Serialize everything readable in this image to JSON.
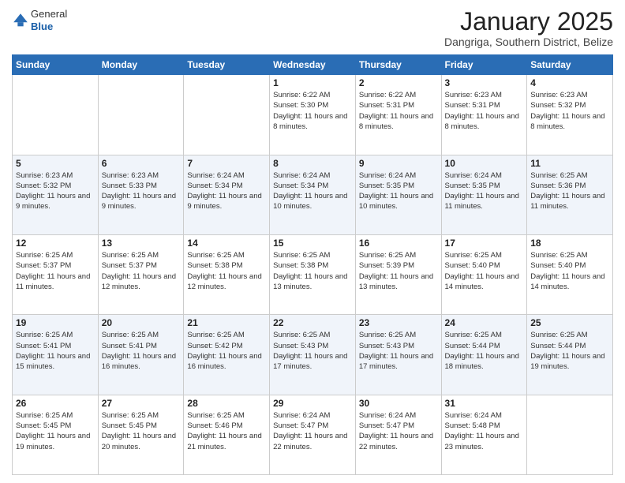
{
  "header": {
    "logo_general": "General",
    "logo_blue": "Blue",
    "month_title": "January 2025",
    "location": "Dangriga, Southern District, Belize"
  },
  "days_of_week": [
    "Sunday",
    "Monday",
    "Tuesday",
    "Wednesday",
    "Thursday",
    "Friday",
    "Saturday"
  ],
  "weeks": [
    [
      {
        "day": "",
        "info": ""
      },
      {
        "day": "",
        "info": ""
      },
      {
        "day": "",
        "info": ""
      },
      {
        "day": "1",
        "info": "Sunrise: 6:22 AM\nSunset: 5:30 PM\nDaylight: 11 hours and 8 minutes."
      },
      {
        "day": "2",
        "info": "Sunrise: 6:22 AM\nSunset: 5:31 PM\nDaylight: 11 hours and 8 minutes."
      },
      {
        "day": "3",
        "info": "Sunrise: 6:23 AM\nSunset: 5:31 PM\nDaylight: 11 hours and 8 minutes."
      },
      {
        "day": "4",
        "info": "Sunrise: 6:23 AM\nSunset: 5:32 PM\nDaylight: 11 hours and 8 minutes."
      }
    ],
    [
      {
        "day": "5",
        "info": "Sunrise: 6:23 AM\nSunset: 5:32 PM\nDaylight: 11 hours and 9 minutes."
      },
      {
        "day": "6",
        "info": "Sunrise: 6:23 AM\nSunset: 5:33 PM\nDaylight: 11 hours and 9 minutes."
      },
      {
        "day": "7",
        "info": "Sunrise: 6:24 AM\nSunset: 5:34 PM\nDaylight: 11 hours and 9 minutes."
      },
      {
        "day": "8",
        "info": "Sunrise: 6:24 AM\nSunset: 5:34 PM\nDaylight: 11 hours and 10 minutes."
      },
      {
        "day": "9",
        "info": "Sunrise: 6:24 AM\nSunset: 5:35 PM\nDaylight: 11 hours and 10 minutes."
      },
      {
        "day": "10",
        "info": "Sunrise: 6:24 AM\nSunset: 5:35 PM\nDaylight: 11 hours and 11 minutes."
      },
      {
        "day": "11",
        "info": "Sunrise: 6:25 AM\nSunset: 5:36 PM\nDaylight: 11 hours and 11 minutes."
      }
    ],
    [
      {
        "day": "12",
        "info": "Sunrise: 6:25 AM\nSunset: 5:37 PM\nDaylight: 11 hours and 11 minutes."
      },
      {
        "day": "13",
        "info": "Sunrise: 6:25 AM\nSunset: 5:37 PM\nDaylight: 11 hours and 12 minutes."
      },
      {
        "day": "14",
        "info": "Sunrise: 6:25 AM\nSunset: 5:38 PM\nDaylight: 11 hours and 12 minutes."
      },
      {
        "day": "15",
        "info": "Sunrise: 6:25 AM\nSunset: 5:38 PM\nDaylight: 11 hours and 13 minutes."
      },
      {
        "day": "16",
        "info": "Sunrise: 6:25 AM\nSunset: 5:39 PM\nDaylight: 11 hours and 13 minutes."
      },
      {
        "day": "17",
        "info": "Sunrise: 6:25 AM\nSunset: 5:40 PM\nDaylight: 11 hours and 14 minutes."
      },
      {
        "day": "18",
        "info": "Sunrise: 6:25 AM\nSunset: 5:40 PM\nDaylight: 11 hours and 14 minutes."
      }
    ],
    [
      {
        "day": "19",
        "info": "Sunrise: 6:25 AM\nSunset: 5:41 PM\nDaylight: 11 hours and 15 minutes."
      },
      {
        "day": "20",
        "info": "Sunrise: 6:25 AM\nSunset: 5:41 PM\nDaylight: 11 hours and 16 minutes."
      },
      {
        "day": "21",
        "info": "Sunrise: 6:25 AM\nSunset: 5:42 PM\nDaylight: 11 hours and 16 minutes."
      },
      {
        "day": "22",
        "info": "Sunrise: 6:25 AM\nSunset: 5:43 PM\nDaylight: 11 hours and 17 minutes."
      },
      {
        "day": "23",
        "info": "Sunrise: 6:25 AM\nSunset: 5:43 PM\nDaylight: 11 hours and 17 minutes."
      },
      {
        "day": "24",
        "info": "Sunrise: 6:25 AM\nSunset: 5:44 PM\nDaylight: 11 hours and 18 minutes."
      },
      {
        "day": "25",
        "info": "Sunrise: 6:25 AM\nSunset: 5:44 PM\nDaylight: 11 hours and 19 minutes."
      }
    ],
    [
      {
        "day": "26",
        "info": "Sunrise: 6:25 AM\nSunset: 5:45 PM\nDaylight: 11 hours and 19 minutes."
      },
      {
        "day": "27",
        "info": "Sunrise: 6:25 AM\nSunset: 5:45 PM\nDaylight: 11 hours and 20 minutes."
      },
      {
        "day": "28",
        "info": "Sunrise: 6:25 AM\nSunset: 5:46 PM\nDaylight: 11 hours and 21 minutes."
      },
      {
        "day": "29",
        "info": "Sunrise: 6:24 AM\nSunset: 5:47 PM\nDaylight: 11 hours and 22 minutes."
      },
      {
        "day": "30",
        "info": "Sunrise: 6:24 AM\nSunset: 5:47 PM\nDaylight: 11 hours and 22 minutes."
      },
      {
        "day": "31",
        "info": "Sunrise: 6:24 AM\nSunset: 5:48 PM\nDaylight: 11 hours and 23 minutes."
      },
      {
        "day": "",
        "info": ""
      }
    ]
  ]
}
